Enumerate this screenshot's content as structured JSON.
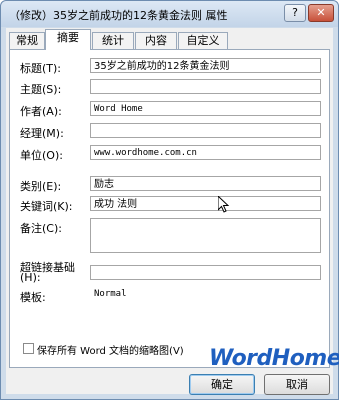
{
  "window": {
    "title": "（修改）35岁之前成功的12条黄金法则 属性",
    "help": "?",
    "close": "✕"
  },
  "tabs": [
    "常规",
    "摘要",
    "统计",
    "内容",
    "自定义"
  ],
  "fields": {
    "title_label": "标题(T):",
    "title_value": "35岁之前成功的12条黄金法则",
    "subject_label": "主题(S):",
    "subject_value": "",
    "author_label": "作者(A):",
    "author_value": "Word Home",
    "manager_label": "经理(M):",
    "manager_value": "",
    "company_label": "单位(O):",
    "company_value": "www.wordhome.com.cn",
    "category_label": "类别(E):",
    "category_value": "励志",
    "keywords_label": "关键词(K):",
    "keywords_value": "成功 法则",
    "comments_label": "备注(C):",
    "comments_value": "",
    "hyperlink_label_1": "超链接基础",
    "hyperlink_label_2": "(H):",
    "hyperlink_value": "",
    "template_label": "模板:",
    "template_value": "Normal"
  },
  "checkbox": {
    "label": "保存所有 Word 文档的缩略图(V)",
    "checked": false
  },
  "watermark": "WordHome",
  "buttons": {
    "ok": "确定",
    "cancel": "取消"
  }
}
